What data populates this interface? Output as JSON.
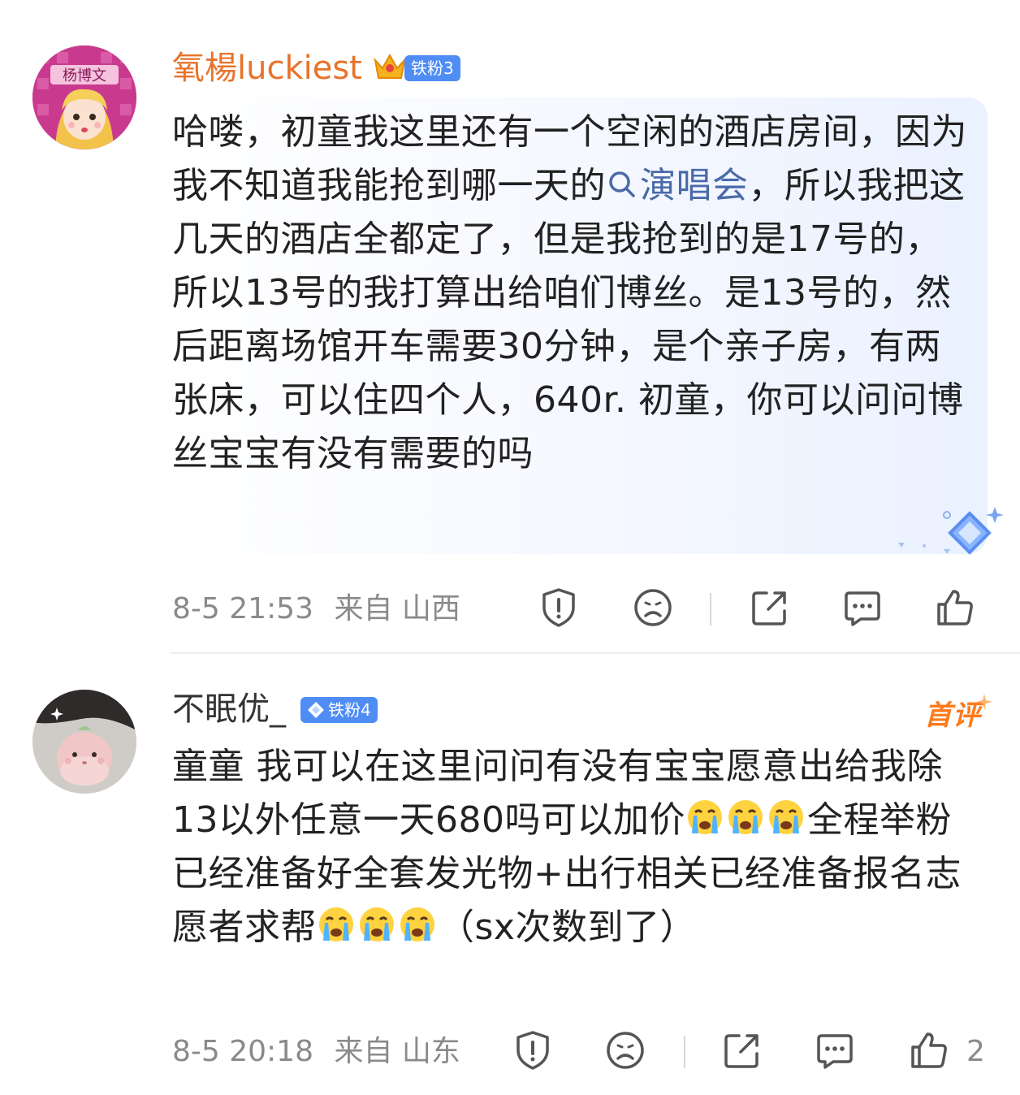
{
  "comments": [
    {
      "username": "氧楊luckiest",
      "badge": "铁粉3",
      "avatar_text": "杨博文",
      "text_before": "哈喽，初童我这里还有一个空闲的酒店房间，因为我不知道我能抢到哪一天的",
      "topic": "演唱会",
      "text_after": "，所以我把这几天的酒店全都定了，但是我抢到的是17号的，所以13号的我打算出给咱们博丝。是13号的，然后距离场馆开车需要30分钟，是个亲子房，有两张床，可以住四个人，640r. 初童，你可以问问博丝宝宝有没有需要的吗",
      "time": "8-5 21:53",
      "location": "来自 山西",
      "like_count": "",
      "username_color": "#e8732a"
    },
    {
      "username": "不眠优_",
      "badge": "铁粉4",
      "first_tag": "首评",
      "text_part1": "童童 我可以在这里问问有没有宝宝愿意出给我除13以外任意一天680吗可以加价",
      "text_part2": "全程举粉已经准备好全套发光物+出行相关已经准备报名志愿者求帮",
      "text_part3": "（sx次数到了）",
      "emoji_name": "crying-face-emoji",
      "time": "8-5 20:18",
      "location": "来自 山东",
      "like_count": "2",
      "username_color": "#333333"
    }
  ],
  "colors": {
    "accent_blue": "#4f8df5",
    "topic_blue": "#4a6aa8",
    "meta_gray": "#8a8a8a"
  }
}
